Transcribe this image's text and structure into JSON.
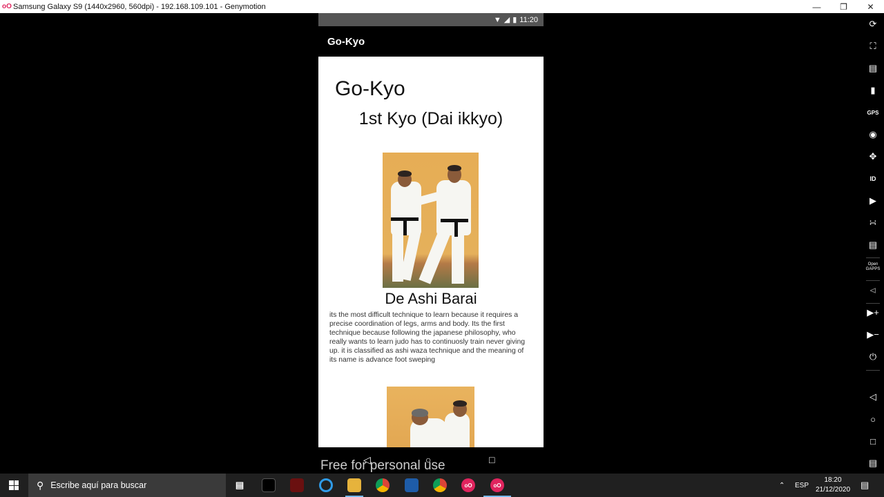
{
  "window": {
    "title": "Samsung Galaxy S9 (1440x2960, 560dpi) - 192.168.109.101 - Genymotion"
  },
  "phone": {
    "status_time": "11:20",
    "app_title": "Go-Kyo",
    "page_heading": "Go-Kyo",
    "subheading": "1st Kyo (Dai ikkyo)",
    "technique": {
      "name": "De Ashi Barai",
      "description": "its the most difficult technique to learn because it requires a precise coordination of legs, arms and body. Its the first technique because following the japanese philosophy, who really wants to learn judo has to continuosly train never giving up. it is classified as ashi waza technique and the meaning of its name is advance foot sweping"
    },
    "watermark": "Free for personal use"
  },
  "taskbar": {
    "search_placeholder": "Escribe aquí para buscar",
    "language": "ESP",
    "time": "18:20",
    "date": "21/12/2020"
  },
  "toolbar_icons": [
    "rotate-icon",
    "fullscreen-icon",
    "capture-icon",
    "battery-icon",
    "gps-icon",
    "camera-icon",
    "dpad-icon",
    "device-id-icon",
    "media-icon",
    "network-icon",
    "sms-icon",
    "open-gapps-icon",
    "share-icon",
    "volume-up-icon",
    "volume-down-icon",
    "power-icon",
    "back-icon",
    "home-icon",
    "recents-icon",
    "menu-icon"
  ],
  "toolbar_labels": {
    "gps": "GPS",
    "id": "ID",
    "open_gapps": "Open GAPPS"
  }
}
